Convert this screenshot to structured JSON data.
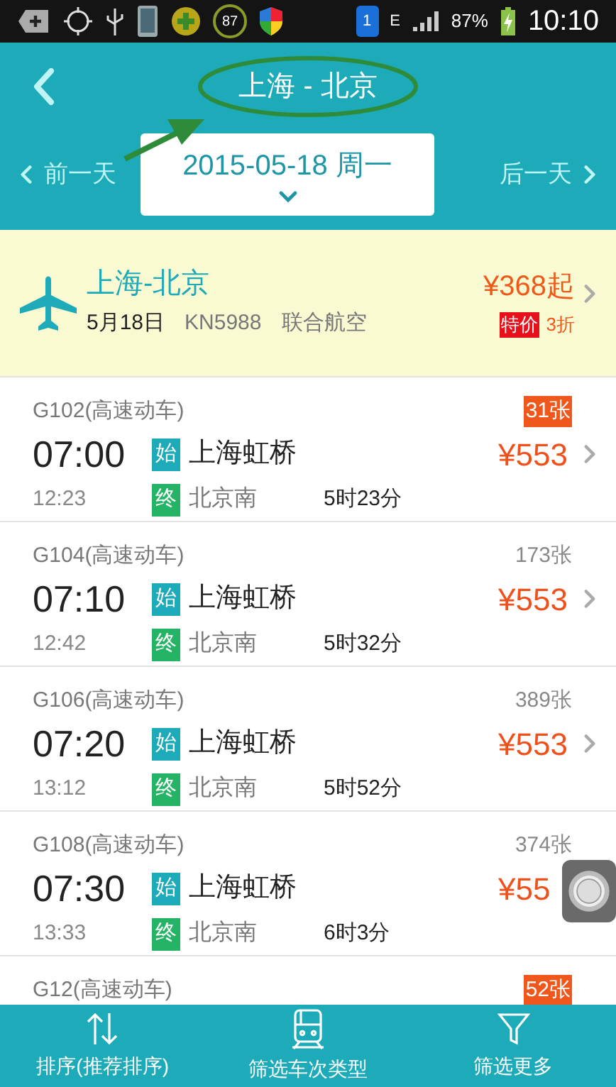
{
  "status_bar": {
    "badge": "87",
    "sim": "1",
    "network": "E",
    "battery": "87%",
    "time": "10:10"
  },
  "header": {
    "title": "上海 - 北京"
  },
  "date_nav": {
    "prev": "前一天",
    "date": "2015-05-18 周一",
    "next": "后一天"
  },
  "flight": {
    "route": "上海-北京",
    "date": "5月18日",
    "flight_no": "KN5988",
    "airline": "联合航空",
    "price": "¥368起",
    "tag": "特价",
    "discount": "3折"
  },
  "trains": [
    {
      "number": "G102(高速动车)",
      "tickets": "31张",
      "low_stock": true,
      "depart": "07:00",
      "from": "上海虹桥",
      "from_tag": "始",
      "arrive": "12:23",
      "to": "北京南",
      "to_tag": "终",
      "duration": "5时23分",
      "price": "¥553",
      "chevron": true
    },
    {
      "number": "G104(高速动车)",
      "tickets": "173张",
      "low_stock": false,
      "depart": "07:10",
      "from": "上海虹桥",
      "from_tag": "始",
      "arrive": "12:42",
      "to": "北京南",
      "to_tag": "终",
      "duration": "5时32分",
      "price": "¥553",
      "chevron": true
    },
    {
      "number": "G106(高速动车)",
      "tickets": "389张",
      "low_stock": false,
      "depart": "07:20",
      "from": "上海虹桥",
      "from_tag": "始",
      "arrive": "13:12",
      "to": "北京南",
      "to_tag": "终",
      "duration": "5时52分",
      "price": "¥553",
      "chevron": true
    },
    {
      "number": "G108(高速动车)",
      "tickets": "374张",
      "low_stock": false,
      "depart": "07:30",
      "from": "上海虹桥",
      "from_tag": "始",
      "arrive": "13:33",
      "to": "北京南",
      "to_tag": "终",
      "duration": "6时3分",
      "price": "¥55"
    },
    {
      "number": "G12(高速动车)",
      "tickets": "52张",
      "low_stock": true
    }
  ],
  "bottom_tabs": [
    {
      "kind": "sort",
      "label": "排序(推荐排序)"
    },
    {
      "kind": "train",
      "label": "筛选车次类型"
    },
    {
      "kind": "filter",
      "label": "筛选更多"
    }
  ]
}
